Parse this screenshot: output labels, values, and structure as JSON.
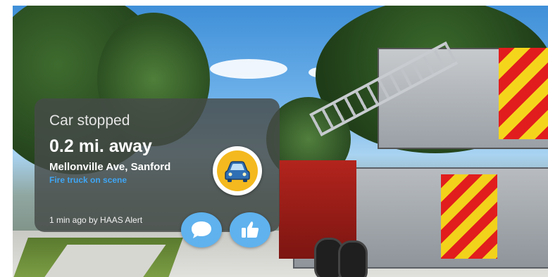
{
  "alert": {
    "type": "Car stopped",
    "distance": "0.2 mi. away",
    "location": "Mellonville Ave, Sanford",
    "detail": "Fire truck on scene",
    "source": "1 min ago by HAAS Alert"
  },
  "icons": {
    "badge": "car-icon",
    "comment": "speech-bubble-icon",
    "like": "thumbs-up-icon"
  },
  "colors": {
    "card_bg": "#464a48",
    "detail_text": "#3fa6f5",
    "badge_yellow": "#f4b91e",
    "action_blue": "#5fb2ee"
  }
}
